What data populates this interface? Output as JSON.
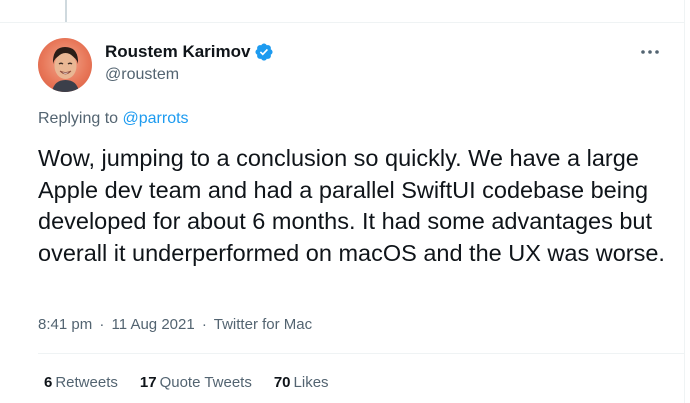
{
  "author": {
    "display_name": "Roustem Karimov",
    "handle": "@roustem",
    "verified": true
  },
  "reply": {
    "prefix": "Replying to",
    "target": "@parrots"
  },
  "tweet": {
    "text": "Wow, jumping to a conclusion so quickly. We have a large Apple dev team and had a parallel SwiftUI codebase being developed for about 6 months. It had some advantages but overall it underperformed on macOS and the UX was worse.",
    "time": "8:41 pm",
    "separator": "·",
    "date": "11 Aug 2021",
    "source": "Twitter for Mac"
  },
  "stats": {
    "retweets_count": "6",
    "retweets_label": "Retweets",
    "quotes_count": "17",
    "quotes_label": "Quote Tweets",
    "likes_count": "70",
    "likes_label": "Likes"
  },
  "icons": {
    "verified": "verified-badge-icon",
    "more": "more-horizontal-icon"
  },
  "colors": {
    "accent": "#1d9bf0",
    "text_primary": "#0f1419",
    "text_secondary": "#536471",
    "divider": "#eff3f4"
  }
}
